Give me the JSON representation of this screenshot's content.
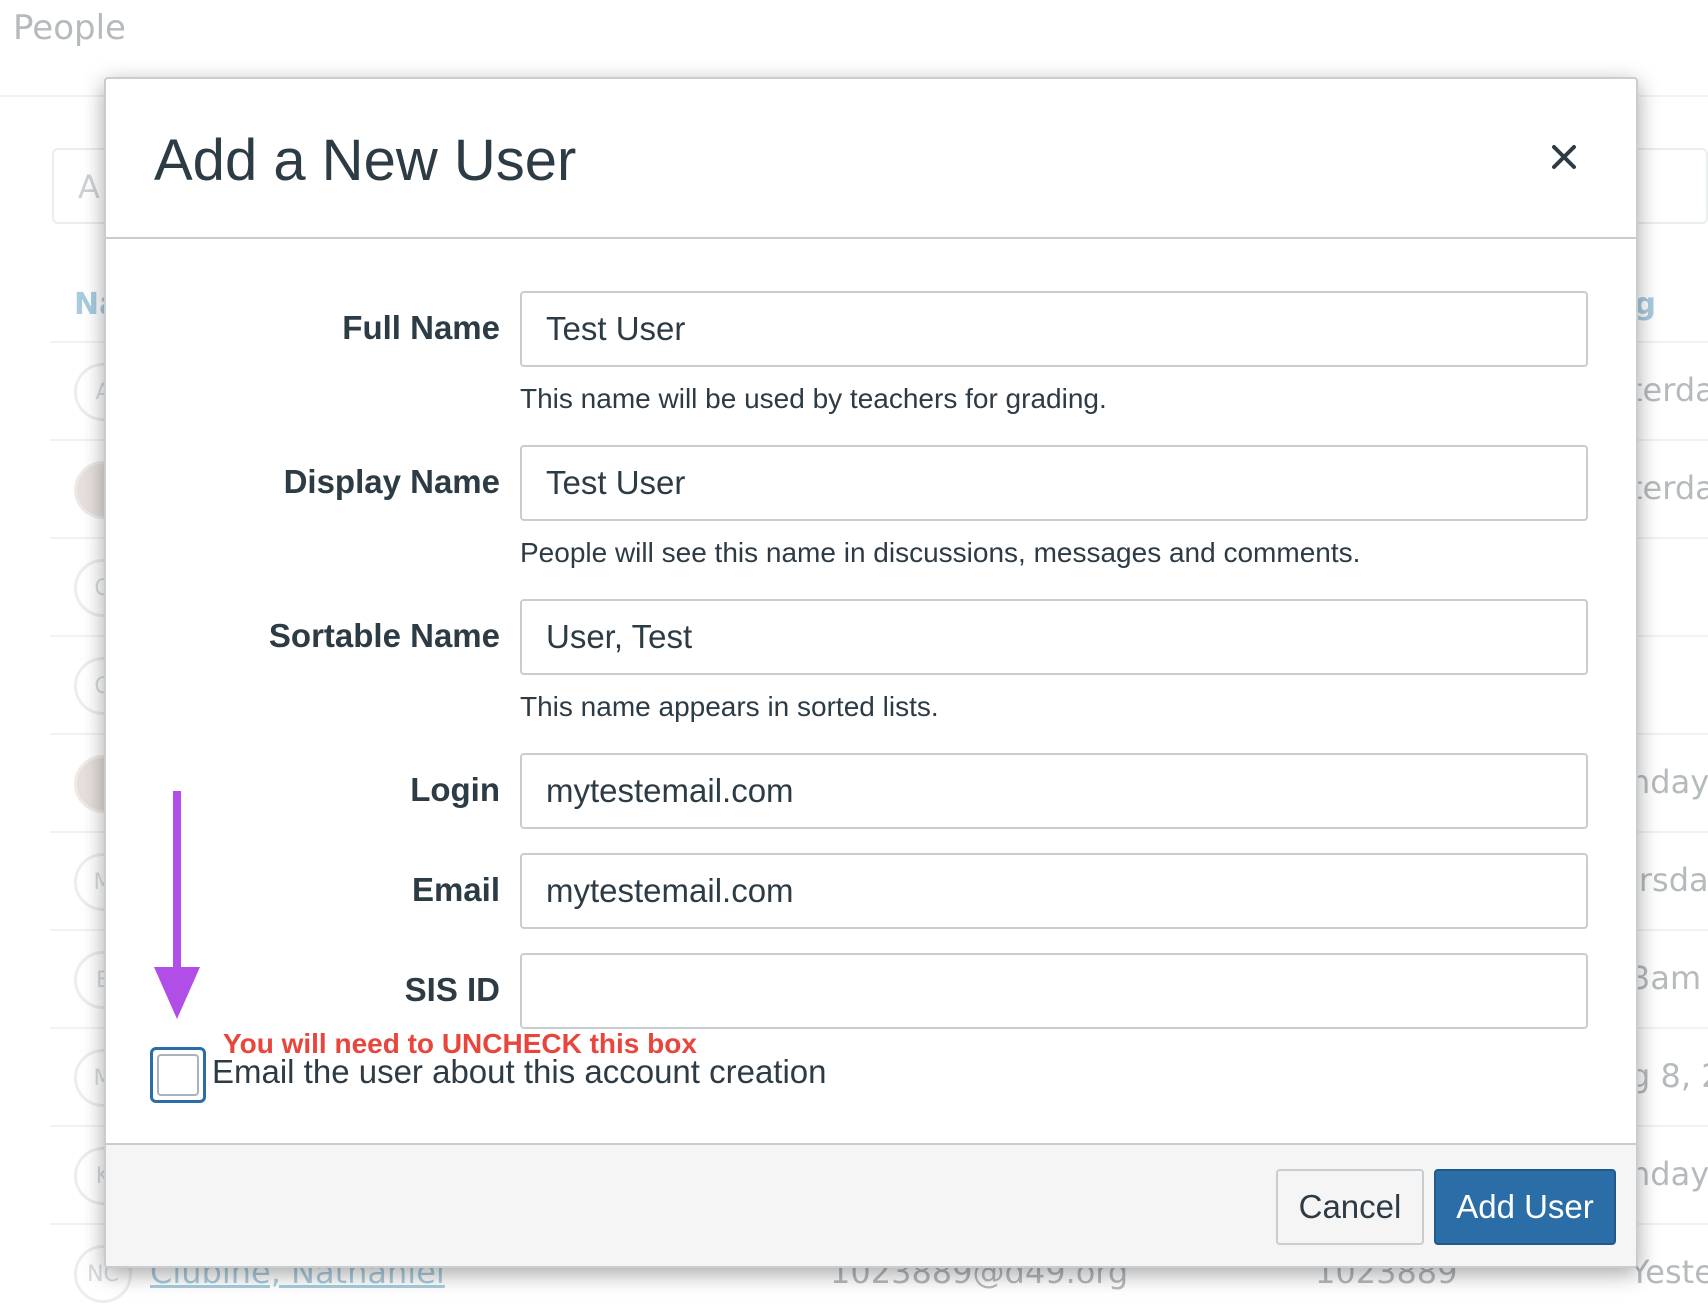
{
  "background": {
    "page_title": "People",
    "search_placeholder": "A",
    "col_name": "Na",
    "col_last_login": "t Log",
    "rows": [
      {
        "avatar": "A",
        "name": "",
        "email": "",
        "sis": "",
        "last": "terda"
      },
      {
        "avatar": "",
        "name": "",
        "email": "",
        "sis": "",
        "last": "terda"
      },
      {
        "avatar": "O",
        "name": "",
        "email": "",
        "sis": "",
        "last": ""
      },
      {
        "avatar": "Q",
        "name": "",
        "email": "",
        "sis": "",
        "last": ""
      },
      {
        "avatar": "",
        "name": "",
        "email": "",
        "sis": "",
        "last": "nday"
      },
      {
        "avatar": "M",
        "name": "",
        "email": "",
        "sis": "",
        "last": "ırsday"
      },
      {
        "avatar": "E",
        "name": "",
        "email": "",
        "sis": "",
        "last": "3am"
      },
      {
        "avatar": "M",
        "name": "",
        "email": "",
        "sis": "",
        "last": "g 8, 2"
      },
      {
        "avatar": "K",
        "name": "",
        "email": "",
        "sis": "",
        "last": "nday"
      },
      {
        "avatar": "NC",
        "name": "Clubine, Nathaniel",
        "email": "1023889@d49.org",
        "sis": "1023889",
        "last": "Yesterda"
      }
    ]
  },
  "modal": {
    "title": "Add a New User",
    "close_label": "×",
    "fields": {
      "full_name": {
        "label": "Full Name",
        "value": "Test User",
        "hint": "This name will be used by teachers for grading."
      },
      "display_name": {
        "label": "Display Name",
        "value": "Test User",
        "hint": "People will see this name in discussions, messages and comments."
      },
      "sortable_name": {
        "label": "Sortable Name",
        "value": "User, Test",
        "hint": "This name appears in sorted lists."
      },
      "login": {
        "label": "Login",
        "value": "mytestemail.com"
      },
      "email": {
        "label": "Email",
        "value": "mytestemail.com"
      },
      "sis_id": {
        "label": "SIS ID",
        "value": ""
      }
    },
    "annotation": "You will need to UNCHECK this box",
    "email_checkbox_label": "Email the user about this account creation",
    "email_checkbox_checked": false,
    "cancel_label": "Cancel",
    "add_label": "Add User"
  },
  "colors": {
    "primary": "#2b6ea7",
    "annotation_arrow": "#b14ee8",
    "annotation_text": "#e8453c",
    "text": "#2d3b45"
  },
  "icons": {
    "close": "close-icon",
    "arrow": "arrow-down-icon"
  }
}
